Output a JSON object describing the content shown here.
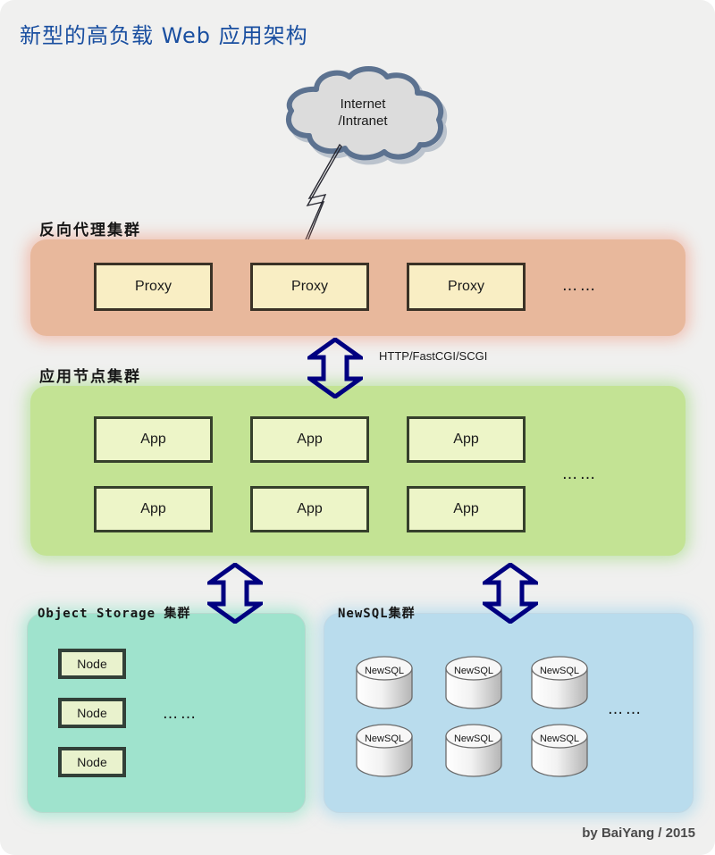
{
  "title": "新型的高负载 Web 应用架构",
  "cloud": {
    "name": "cloud-node",
    "line1": "Internet",
    "line2": "/Intranet"
  },
  "link": {
    "protocols": "HTTP/FastCGI/SCGI"
  },
  "clusters": {
    "proxy": {
      "label": "反向代理集群",
      "color": "#e8b89c",
      "nodes": [
        "Proxy",
        "Proxy",
        "Proxy"
      ],
      "ellipsis": "……"
    },
    "app": {
      "label": "应用节点集群",
      "color": "#c3e394",
      "row1": [
        "App",
        "App",
        "App"
      ],
      "row2": [
        "App",
        "App",
        "App"
      ],
      "ellipsis": "……"
    },
    "object_storage": {
      "label": "Object Storage 集群",
      "color": "#9fe3cd",
      "nodes": [
        "Node",
        "Node",
        "Node"
      ],
      "ellipsis": "……"
    },
    "newsql": {
      "label": "NewSQL集群",
      "color": "#b9dced",
      "row1": [
        "NewSQL",
        "NewSQL",
        "NewSQL"
      ],
      "row2": [
        "NewSQL",
        "NewSQL",
        "NewSQL"
      ],
      "ellipsis": "……"
    }
  },
  "footer": "by BaiYang / 2015",
  "colors": {
    "title": "#1a4fa0",
    "arrow": "#000080",
    "cloud_fill": "#dcdcdc",
    "cloud_stroke": "#5c7290",
    "box_fill_proxy": "#f9eec4",
    "box_fill_app": "#edf5c8"
  }
}
